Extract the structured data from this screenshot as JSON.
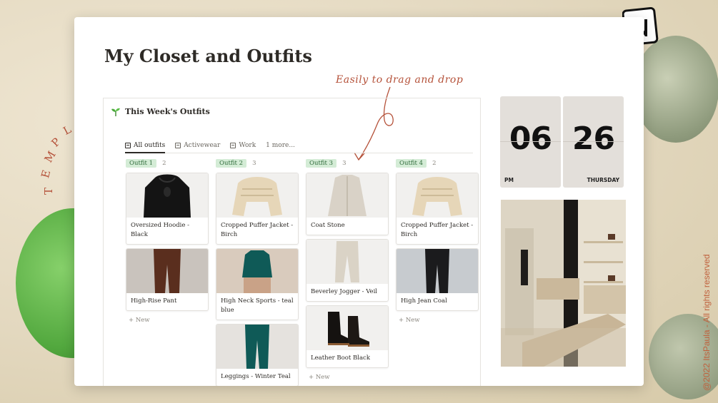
{
  "template_label": "TEMPLATE",
  "page": {
    "title": "My Closet and Outfits"
  },
  "annotation": "Easily to drag and drop",
  "board": {
    "title": "This Week's Outfits",
    "tabs": [
      {
        "label": "All outfits"
      },
      {
        "label": "Activewear"
      },
      {
        "label": "Work"
      },
      {
        "label": "1 more..."
      }
    ],
    "columns": [
      {
        "group": "Outfit 1",
        "count": "2",
        "cards": [
          "Oversized Hoodie - Black",
          "High-Rise Pant"
        ]
      },
      {
        "group": "Outfit 2",
        "count": "3",
        "cards": [
          "Cropped Puffer Jacket - Birch",
          "High Neck Sports - teal blue",
          "Leggings - Winter Teal"
        ]
      },
      {
        "group": "Outfit 3",
        "count": "3",
        "cards": [
          "Coat Stone",
          "Beverley Jogger - Veil",
          "Leather Boot Black"
        ]
      },
      {
        "group": "Outfit 4",
        "count": "2",
        "cards": [
          "Cropped Puffer Jacket - Birch",
          "High Jean Coal"
        ]
      }
    ],
    "new_label": "New"
  },
  "clock": {
    "hour": "06",
    "minute": "26",
    "ampm": "PM",
    "day": "THURSDAY"
  },
  "copyright": "@2022 ItsPaula - All rights reserved",
  "colors": {
    "accent": "#b5523a",
    "pill_bg": "#d4ecd6",
    "pill_text": "#2f6b3a"
  }
}
